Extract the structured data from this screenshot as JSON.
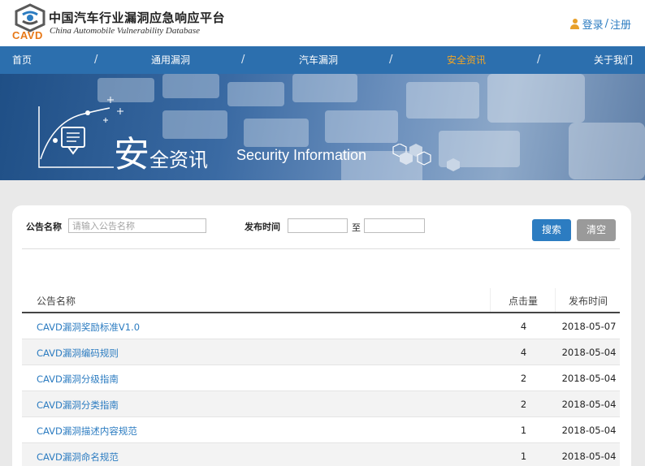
{
  "header": {
    "logo_text": "CAVD",
    "title_cn": "中国汽车行业漏洞应急响应平台",
    "title_en": "China Automobile Vulnerability Database",
    "login": "登录",
    "separator": "/",
    "register": "注册"
  },
  "nav": {
    "items": [
      {
        "label": "首页",
        "active": false
      },
      {
        "label": "通用漏洞",
        "active": false
      },
      {
        "label": "汽车漏洞",
        "active": false
      },
      {
        "label": "安全资讯",
        "active": true
      },
      {
        "label": "关于我们",
        "active": false
      }
    ],
    "separator": "/"
  },
  "banner": {
    "title_big": "安",
    "title_rest": "全资讯",
    "title_en": "Security Information"
  },
  "search": {
    "name_label": "公告名称",
    "name_placeholder": "请输入公告名称",
    "date_label": "发布时间",
    "date_from": "",
    "date_to": "",
    "to_text": "至",
    "search_button": "搜索",
    "clear_button": "清空"
  },
  "table": {
    "columns": [
      "公告名称",
      "点击量",
      "发布时间"
    ],
    "rows": [
      {
        "title": "CAVD漏洞奖励标准V1.0",
        "hits": "4",
        "date": "2018-05-07"
      },
      {
        "title": "CAVD漏洞编码规则",
        "hits": "4",
        "date": "2018-05-04"
      },
      {
        "title": "CAVD漏洞分级指南",
        "hits": "2",
        "date": "2018-05-04"
      },
      {
        "title": "CAVD漏洞分类指南",
        "hits": "2",
        "date": "2018-05-04"
      },
      {
        "title": "CAVD漏洞描述内容规范",
        "hits": "1",
        "date": "2018-05-04"
      },
      {
        "title": "CAVD漏洞命名规范",
        "hits": "1",
        "date": "2018-05-04"
      }
    ]
  },
  "colors": {
    "nav_bg": "#2c6fae",
    "nav_active": "#f5a623",
    "link": "#2c7cc1",
    "logo_orange": "#e77817"
  }
}
